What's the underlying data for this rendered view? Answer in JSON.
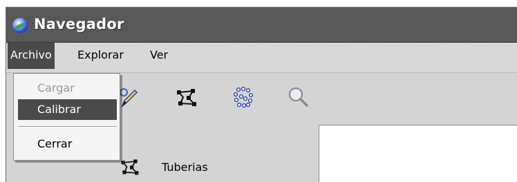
{
  "window": {
    "title": "Navegador",
    "app_icon": "globe-icon"
  },
  "menubar": {
    "items": [
      {
        "label": "Archivo",
        "active": true
      },
      {
        "label": "Explorar",
        "active": false
      },
      {
        "label": "Ver",
        "active": false
      }
    ]
  },
  "dropdown": {
    "items": [
      {
        "label": "Cargar",
        "state": "disabled"
      },
      {
        "label": "Calibrar",
        "state": "highlighted"
      },
      {
        "label": "Cerrar",
        "state": "normal"
      }
    ]
  },
  "toolbar": {
    "icons": [
      "pencil-icon",
      "network-icon",
      "scatter-points-icon",
      "magnifier-icon"
    ]
  },
  "tree": {
    "items": [
      {
        "label": "Tuberias",
        "icon": "network-icon"
      }
    ]
  },
  "colors": {
    "titlebar": "#585858",
    "menu_highlight": "#4a4a4a",
    "window_background": "#d4d4d4"
  }
}
